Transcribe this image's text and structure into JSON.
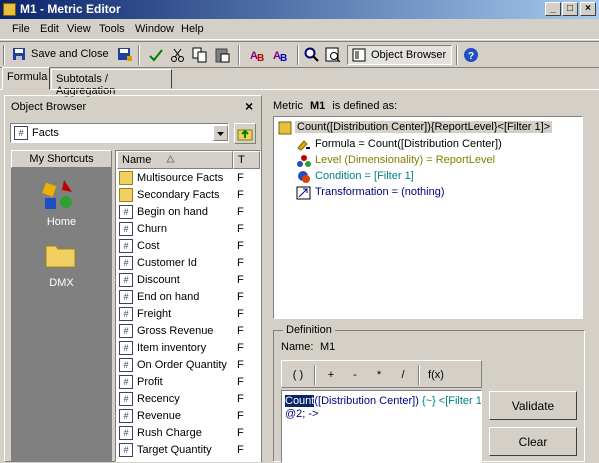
{
  "window": {
    "title": "M1 - Metric Editor",
    "controls": [
      "_",
      "□",
      "×"
    ]
  },
  "menu": [
    {
      "label": "File"
    },
    {
      "label": "Edit"
    },
    {
      "label": "View"
    },
    {
      "label": "Tools"
    },
    {
      "label": "Window"
    },
    {
      "label": "Help"
    }
  ],
  "toolbar": {
    "save_close": "Save and Close",
    "object_browser": "Object Browser"
  },
  "tabs": [
    "Formula",
    "Subtotals / Aggregation"
  ],
  "object_browser": {
    "title": "Object Browser",
    "close_glyph": "×",
    "folder_select": "Facts",
    "shortcuts_button": "My Shortcuts",
    "shortcuts": [
      "Home",
      "DMX"
    ],
    "columns": [
      "Name",
      "T"
    ],
    "items": [
      {
        "name": "Multisource Facts",
        "type": "F",
        "icon": "folder-icon"
      },
      {
        "name": "Secondary Facts",
        "type": "F",
        "icon": "folder-icon"
      },
      {
        "name": "Begin on hand",
        "type": "F",
        "icon": "fact-icon"
      },
      {
        "name": "Churn",
        "type": "F",
        "icon": "fact-icon"
      },
      {
        "name": "Cost",
        "type": "F",
        "icon": "fact-icon"
      },
      {
        "name": "Customer Id",
        "type": "F",
        "icon": "fact-icon"
      },
      {
        "name": "Discount",
        "type": "F",
        "icon": "fact-icon"
      },
      {
        "name": "End on hand",
        "type": "F",
        "icon": "fact-icon"
      },
      {
        "name": "Freight",
        "type": "F",
        "icon": "fact-icon"
      },
      {
        "name": "Gross Revenue",
        "type": "F",
        "icon": "fact-icon"
      },
      {
        "name": "Item inventory",
        "type": "F",
        "icon": "fact-icon"
      },
      {
        "name": "On Order Quantity",
        "type": "F",
        "icon": "fact-icon"
      },
      {
        "name": "Profit",
        "type": "F",
        "icon": "fact-icon"
      },
      {
        "name": "Recency",
        "type": "F",
        "icon": "fact-icon"
      },
      {
        "name": "Revenue",
        "type": "F",
        "icon": "fact-icon"
      },
      {
        "name": "Rush Charge",
        "type": "F",
        "icon": "fact-icon"
      },
      {
        "name": "Target Quantity",
        "type": "F",
        "icon": "fact-icon"
      }
    ]
  },
  "metric": {
    "label_prefix": "Metric",
    "name": "M1",
    "label_suffix": "is defined as:",
    "root": "Count([Distribution Center]){ReportLevel}<[Filter 1]>",
    "children": [
      {
        "text": "Formula = Count([Distribution Center])",
        "color": "#000000"
      },
      {
        "text": "Level (Dimensionality) = ReportLevel",
        "color": "#808000"
      },
      {
        "text": "Condition = [Filter 1]",
        "color": "#008080"
      },
      {
        "text": "Transformation = (nothing)",
        "color": "#000080"
      }
    ]
  },
  "definition": {
    "group_label": "Definition",
    "name_label": "Name:",
    "name_value": "M1",
    "operators": [
      "( )",
      "+",
      "-",
      "*",
      "/",
      "f(x)"
    ],
    "formula_part1": "Count",
    "formula_part2": "([Distribution Center]) ",
    "formula_part3": "{~} <[Filter 1]>",
    "formula_part4": ";",
    "formula_line2": "@2; ->",
    "validate": "Validate",
    "clear": "Clear"
  },
  "colors": {
    "titlebar": "#0a246a",
    "face": "#d4d0c8",
    "shortcut_bg": "#808080"
  }
}
